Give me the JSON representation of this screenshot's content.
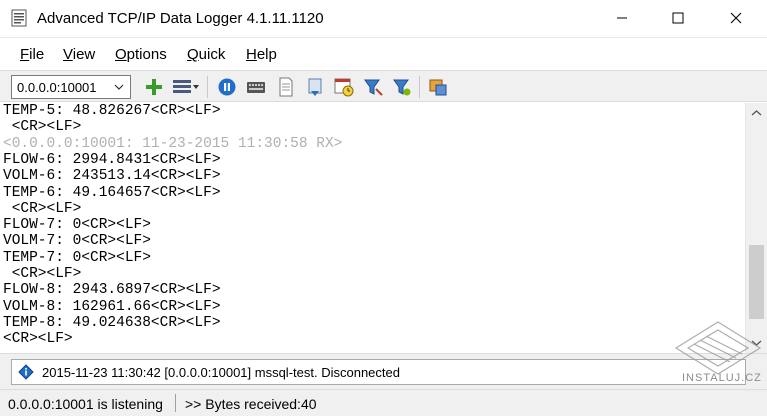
{
  "window": {
    "title": "Advanced TCP/IP Data Logger 4.1.11.1120"
  },
  "menu": {
    "items": [
      {
        "label": "File",
        "mnemonic": "F",
        "rest": "ile"
      },
      {
        "label": "View",
        "mnemonic": "V",
        "rest": "iew"
      },
      {
        "label": "Options",
        "mnemonic": "O",
        "rest": "ptions"
      },
      {
        "label": "Quick",
        "mnemonic": "Q",
        "rest": "uick"
      },
      {
        "label": "Help",
        "mnemonic": "H",
        "rest": "elp"
      }
    ]
  },
  "toolbar": {
    "connection_value": "0.0.0.0:10001",
    "icons": [
      "add-connection-icon",
      "view-options-icon",
      "start-stop-icon",
      "keyboard-icon",
      "document-icon",
      "export-icon",
      "schedule-icon",
      "filter-icon",
      "filter-settings-icon",
      "plugin-icon"
    ]
  },
  "log": {
    "lines": [
      {
        "text": "TEMP-5: 48.826267<CR><LF>",
        "kind": "data"
      },
      {
        "text": " <CR><LF>",
        "kind": "data"
      },
      {
        "text": "<0.0.0.0:10001: 11-23-2015 11:30:58 RX>",
        "kind": "rx"
      },
      {
        "text": "FLOW-6: 2994.8431<CR><LF>",
        "kind": "data"
      },
      {
        "text": "VOLM-6: 243513.14<CR><LF>",
        "kind": "data"
      },
      {
        "text": "TEMP-6: 49.164657<CR><LF>",
        "kind": "data"
      },
      {
        "text": " <CR><LF>",
        "kind": "data"
      },
      {
        "text": "FLOW-7: 0<CR><LF>",
        "kind": "data"
      },
      {
        "text": "VOLM-7: 0<CR><LF>",
        "kind": "data"
      },
      {
        "text": "TEMP-7: 0<CR><LF>",
        "kind": "data"
      },
      {
        "text": " <CR><LF>",
        "kind": "data"
      },
      {
        "text": "FLOW-8: 2943.6897<CR><LF>",
        "kind": "data"
      },
      {
        "text": "VOLM-8: 162961.66<CR><LF>",
        "kind": "data"
      },
      {
        "text": "TEMP-8: 49.024638<CR><LF>",
        "kind": "data"
      },
      {
        "text": "<CR><LF>",
        "kind": "data"
      }
    ]
  },
  "message": {
    "text": "2015-11-23 11:30:42 [0.0.0.0:10001] mssql-test. Disconnected"
  },
  "statusbar": {
    "listening": "0.0.0.0:10001 is listening",
    "bytes": ">> Bytes received:40"
  },
  "watermark": {
    "text": "INSTALUJ.CZ"
  },
  "colors": {
    "rx_line": "#b0b0b0",
    "panel_bg": "#f0f0f0"
  }
}
